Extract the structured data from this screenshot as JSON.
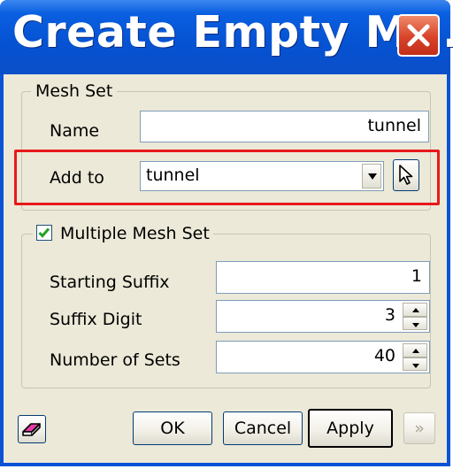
{
  "window": {
    "title": "Create Empty M..."
  },
  "mesh_set": {
    "legend": "Mesh Set",
    "name_label": "Name",
    "name_value": "tunnel",
    "add_to_label": "Add to",
    "add_to_value": "tunnel"
  },
  "multiple": {
    "checkbox_label": "Multiple Mesh Set",
    "checked": true,
    "starting_suffix_label": "Starting Suffix",
    "starting_suffix_value": "1",
    "suffix_digit_label": "Suffix Digit",
    "suffix_digit_value": "3",
    "number_of_sets_label": "Number of Sets",
    "number_of_sets_value": "40"
  },
  "buttons": {
    "ok": "OK",
    "cancel": "Cancel",
    "apply": "Apply",
    "more": "»"
  },
  "colors": {
    "titlebar": "#0552d2",
    "highlight": "#e8191c",
    "close": "#d8432a"
  },
  "icons": [
    "close-icon",
    "dropdown-arrow-icon",
    "pick-pointer-icon",
    "eraser-icon",
    "double-chevron-right-icon"
  ]
}
